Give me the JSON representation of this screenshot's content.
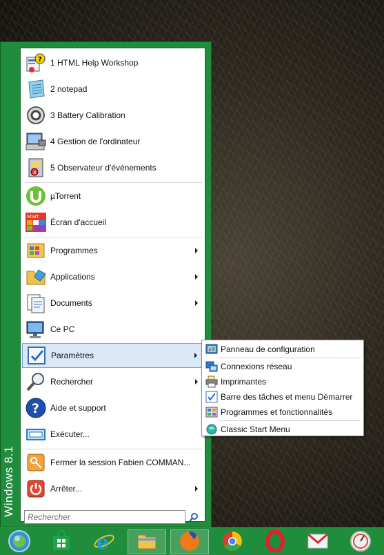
{
  "brand": {
    "text": "Windows 8.1"
  },
  "recent_programs": [
    {
      "label": "1 HTML Help Workshop",
      "icon": "help-workshop-icon"
    },
    {
      "label": "2 notepad",
      "icon": "notepad-icon"
    },
    {
      "label": "3 Battery Calibration",
      "icon": "battery-calibration-icon"
    },
    {
      "label": "4 Gestion de l'ordinateur",
      "icon": "computer-management-icon"
    },
    {
      "label": "5 Observateur d'événements",
      "icon": "event-viewer-icon"
    }
  ],
  "pinned": [
    {
      "label": "µTorrent",
      "icon": "utorrent-icon"
    },
    {
      "label": "Écran d'accueil",
      "icon": "start-screen-icon",
      "badge": "Start"
    }
  ],
  "main_items": [
    {
      "label": "Programmes",
      "icon": "programs-icon",
      "has_submenu": true
    },
    {
      "label": "Applications",
      "icon": "applications-icon",
      "has_submenu": true
    },
    {
      "label": "Documents",
      "icon": "documents-icon",
      "has_submenu": true
    },
    {
      "label": "Ce PC",
      "icon": "this-pc-icon",
      "has_submenu": false
    },
    {
      "label": "Paramètres",
      "icon": "settings-icon",
      "has_submenu": true,
      "selected": true
    },
    {
      "label": "Rechercher",
      "icon": "search-magnifier-icon",
      "has_submenu": true
    },
    {
      "label": "Aide et support",
      "icon": "help-icon",
      "has_submenu": false
    },
    {
      "label": "Exécuter...",
      "icon": "run-icon",
      "has_submenu": false
    }
  ],
  "session_items": [
    {
      "label": "Fermer la session Fabien COMMAN...",
      "icon": "logoff-icon",
      "has_submenu": false
    },
    {
      "label": "Arrêter...",
      "icon": "shutdown-icon",
      "has_submenu": true
    }
  ],
  "search": {
    "placeholder": "Rechercher",
    "icon": "search-icon"
  },
  "settings_submenu": [
    {
      "label": "Panneau de configuration",
      "icon": "control-panel-icon"
    },
    {
      "label": "Connexions réseau",
      "icon": "network-connections-icon"
    },
    {
      "label": "Imprimantes",
      "icon": "printers-icon"
    },
    {
      "label": "Barre des tâches et menu Démarrer",
      "icon": "taskbar-settings-icon"
    },
    {
      "label": "Programmes et fonctionnalités",
      "icon": "programs-features-icon"
    },
    {
      "label": "Classic Start Menu",
      "icon": "classic-start-menu-icon"
    }
  ],
  "taskbar": [
    {
      "name": "start-orb",
      "icon": "start-orb-icon"
    },
    {
      "name": "store",
      "icon": "windows-store-icon"
    },
    {
      "name": "internet-explorer",
      "icon": "internet-explorer-icon"
    },
    {
      "name": "file-explorer",
      "icon": "file-explorer-icon",
      "active": true
    },
    {
      "name": "firefox",
      "icon": "firefox-icon",
      "active": true
    },
    {
      "name": "chrome",
      "icon": "chrome-icon"
    },
    {
      "name": "opera",
      "icon": "opera-icon"
    },
    {
      "name": "mail",
      "icon": "mail-icon"
    },
    {
      "name": "speed-dial",
      "icon": "speedometer-icon"
    }
  ],
  "colors": {
    "accent": "#1f8d3b",
    "selection": "#dbe8f8",
    "selection_border": "#7da2ce"
  }
}
